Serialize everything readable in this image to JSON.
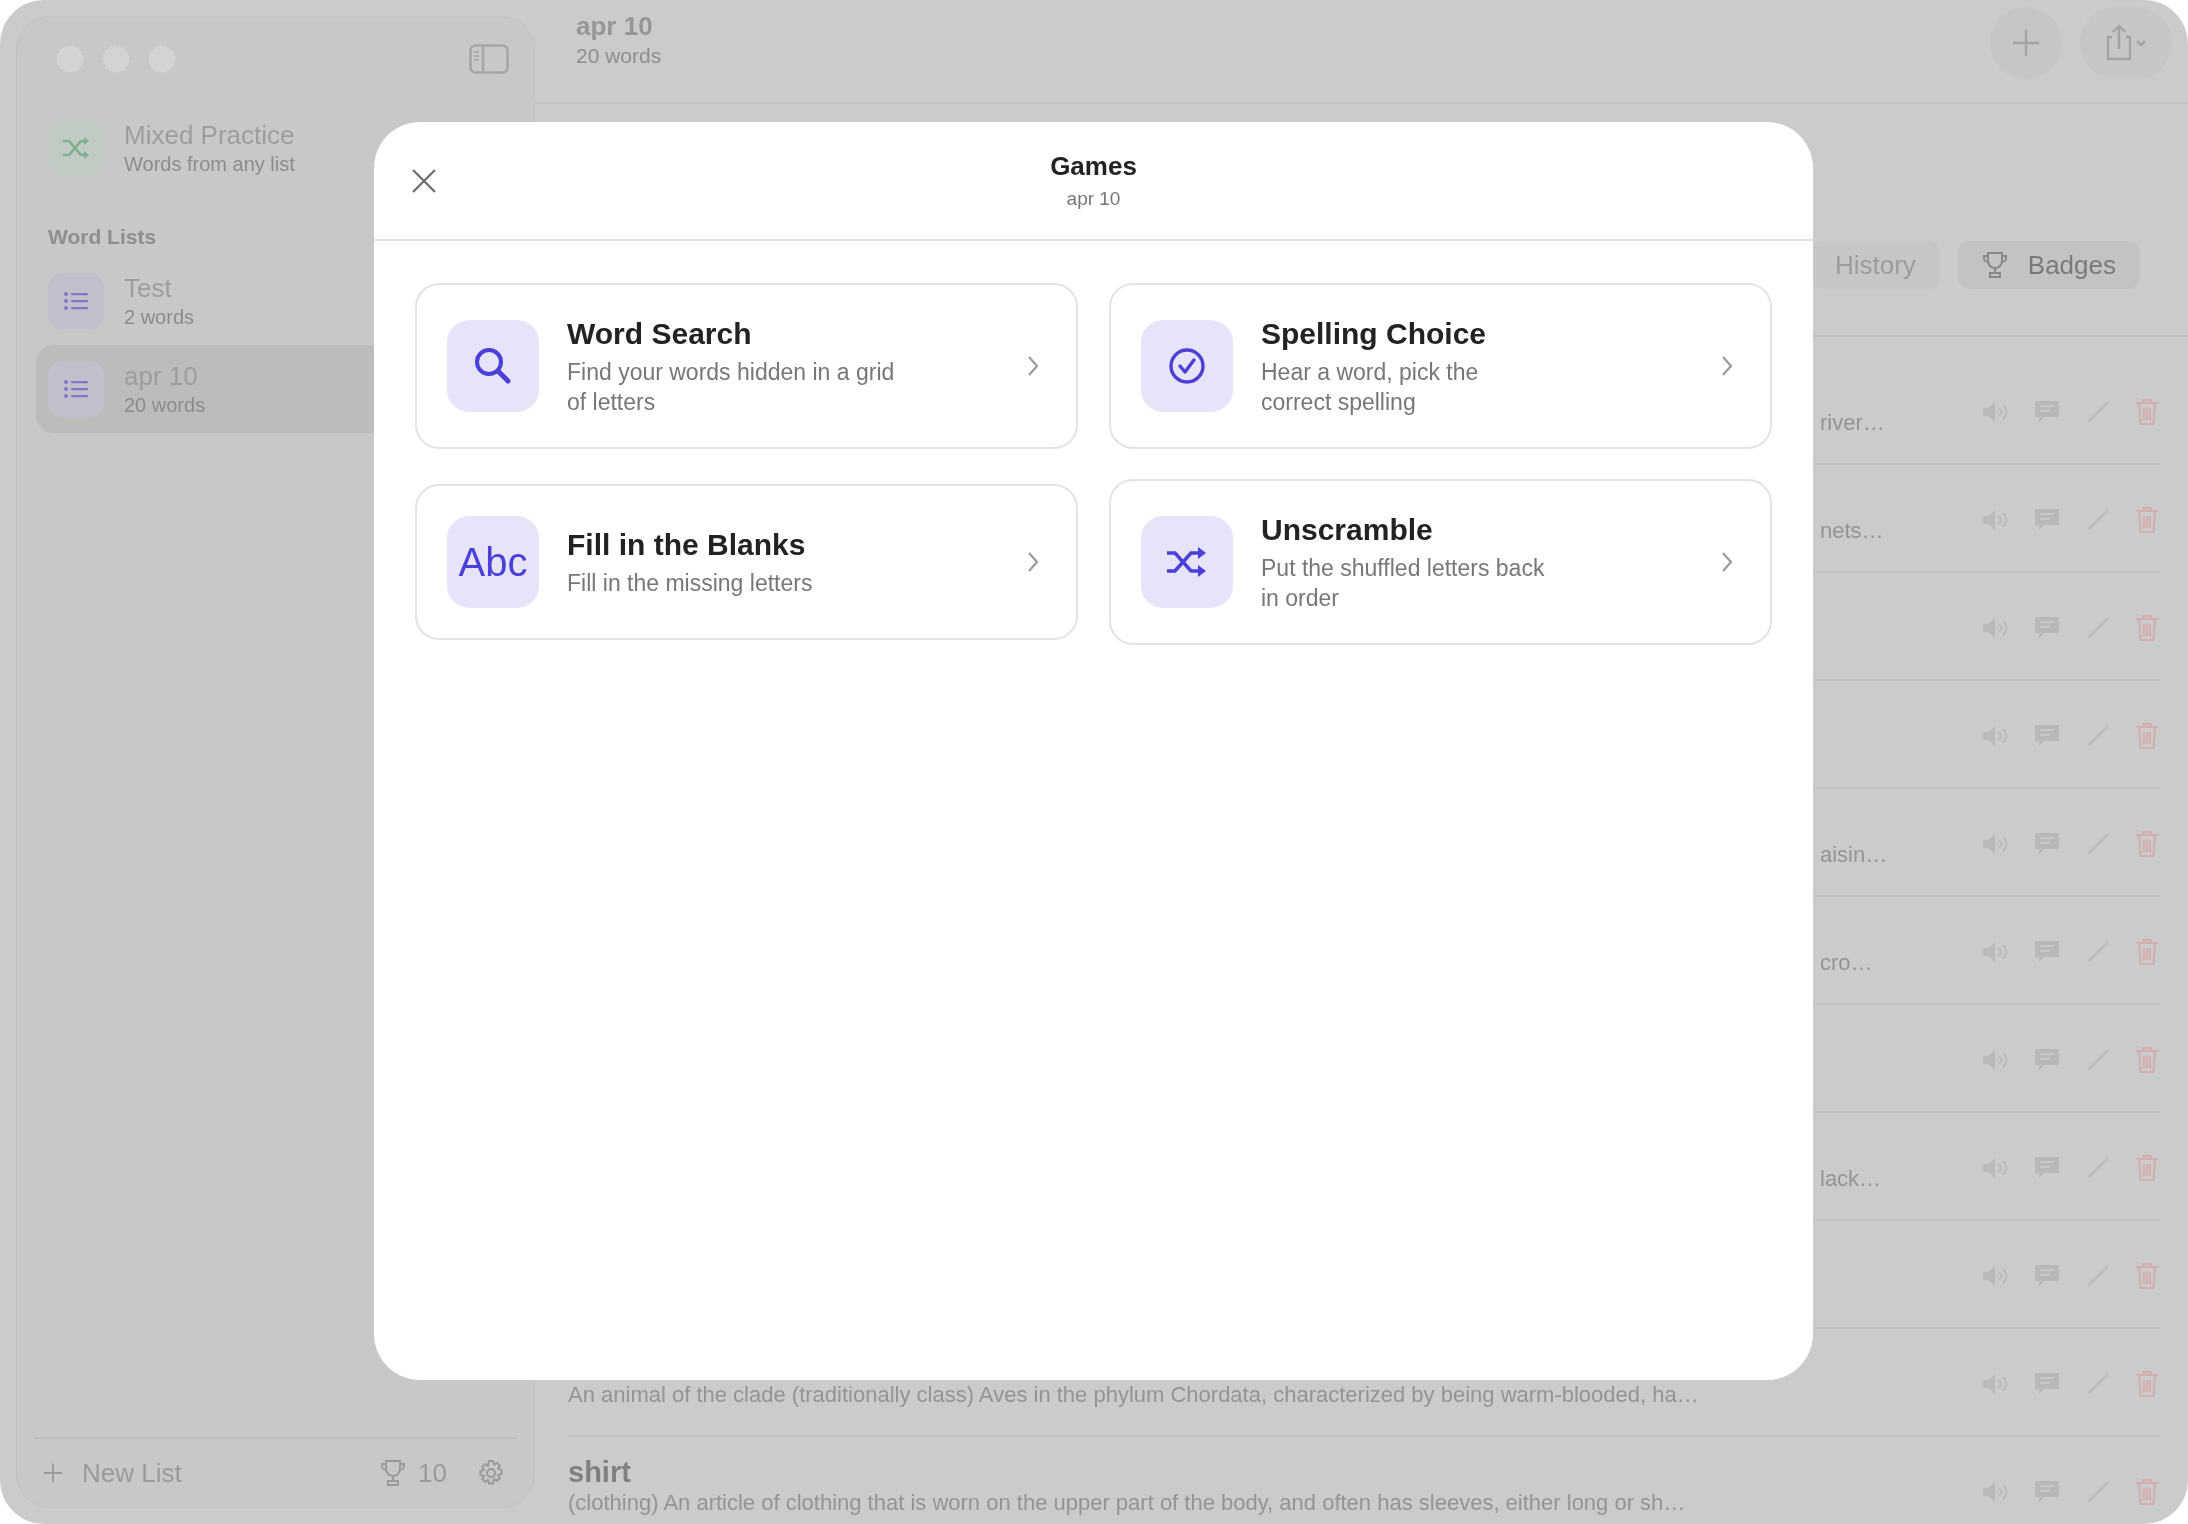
{
  "sidebar": {
    "practice": {
      "title": "Mixed Practice",
      "subtitle": "Words from any list"
    },
    "section_title": "Word Lists",
    "lists": [
      {
        "title": "Test",
        "subtitle": "2 words",
        "selected": false
      },
      {
        "title": "apr 10",
        "subtitle": "20 words",
        "selected": true
      }
    ],
    "footer": {
      "new_list": "New List",
      "trophy_count": "10"
    }
  },
  "header": {
    "title": "apr 10",
    "subtitle": "20 words"
  },
  "tabs": [
    {
      "label": "History",
      "selected": false
    },
    {
      "label": "Badges",
      "selected": true
    }
  ],
  "words": [
    {
      "kind": "partial",
      "description": "river…"
    },
    {
      "kind": "partial",
      "description": "nets…"
    },
    {
      "kind": "partial"
    },
    {
      "kind": "partial"
    },
    {
      "kind": "partial",
      "description": "aisin…"
    },
    {
      "kind": "partial",
      "description": "cro…"
    },
    {
      "kind": "partial"
    },
    {
      "kind": "partial",
      "description": "lack…"
    },
    {
      "kind": "partial"
    },
    {
      "kind": "full",
      "description": "An animal of the clade (traditionally class) Aves in the phylum Chordata, characterized by being warm-blooded, ha…"
    },
    {
      "kind": "full",
      "title": "shirt",
      "description": "(clothing) An article of clothing that is worn on the upper part of the body, and often has sleeves, either long or sh…"
    }
  ],
  "modal": {
    "title": "Games",
    "subtitle": "apr 10",
    "games": [
      {
        "title": "Word Search",
        "description": "Find your words hidden in a grid\nof letters"
      },
      {
        "title": "Spelling Choice",
        "description": "Hear a word, pick the\ncorrect spelling"
      },
      {
        "title": "Fill in the Blanks",
        "description": "Fill in the missing letters",
        "icon_label": "Abc"
      },
      {
        "title": "Unscramble",
        "description": "Put the shuffled letters back\nin order"
      }
    ]
  }
}
